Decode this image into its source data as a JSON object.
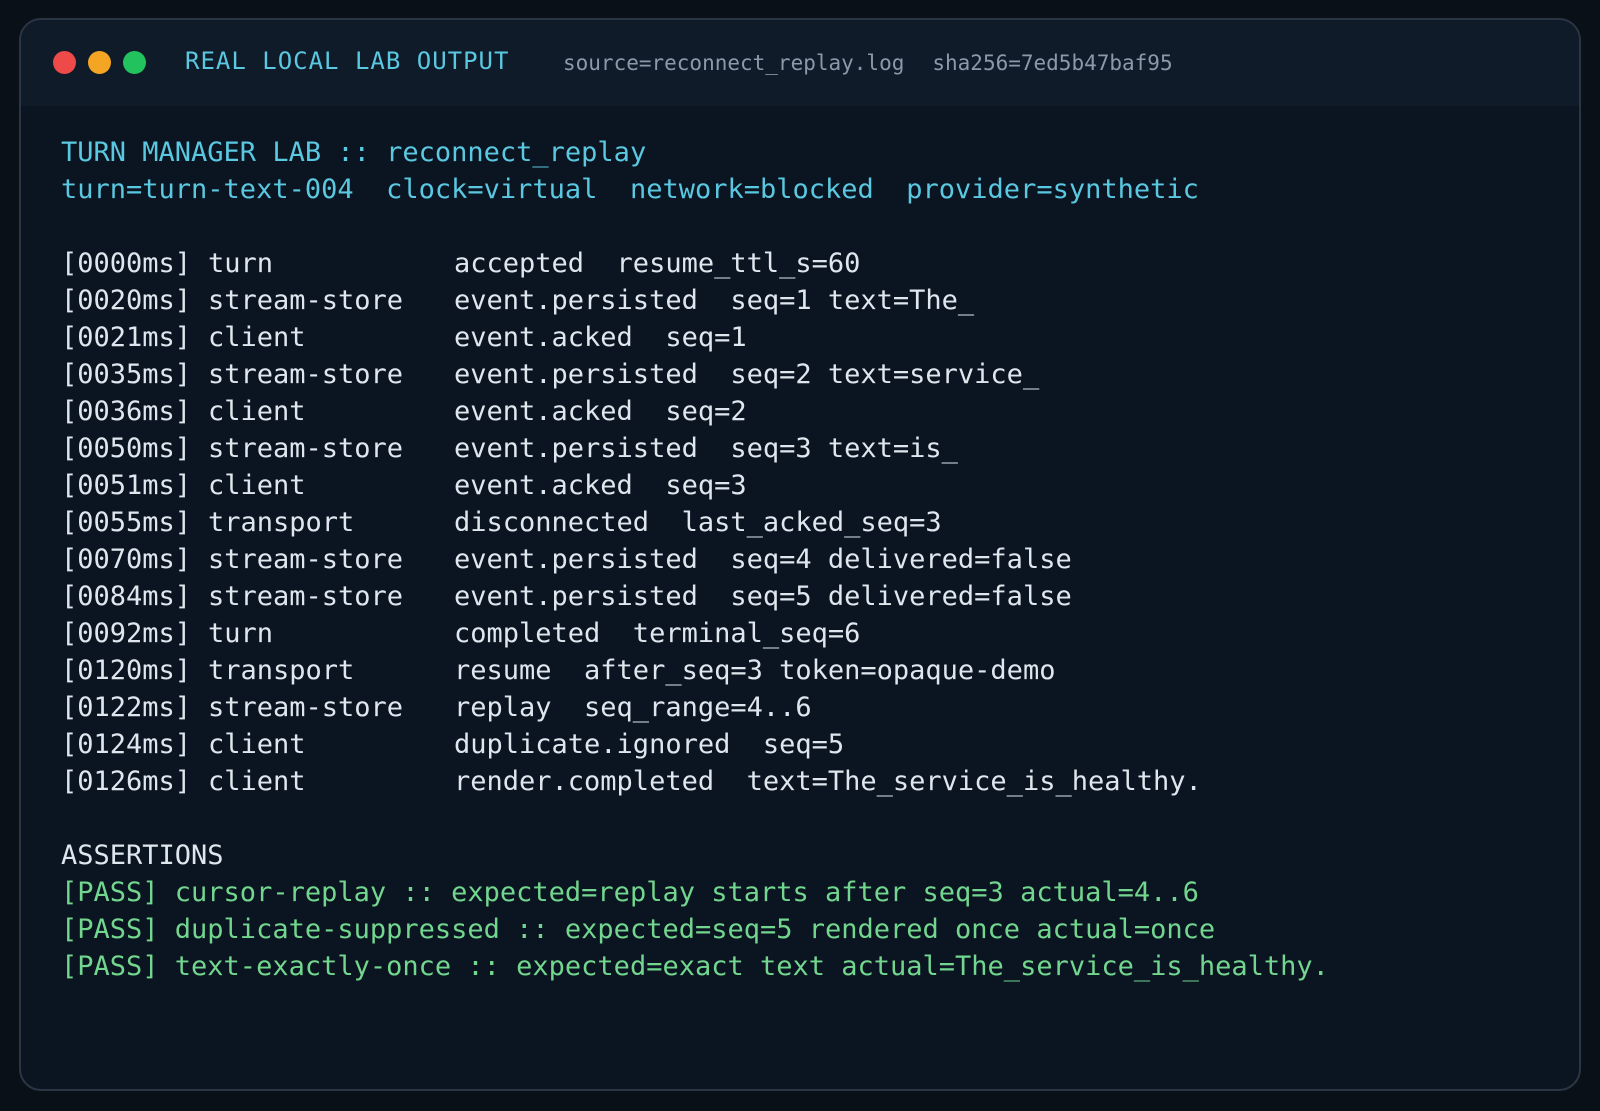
{
  "window": {
    "title": "REAL LOCAL LAB OUTPUT",
    "source": "source=reconnect_replay.log",
    "sha": "sha256=7ed5b47baf95"
  },
  "header": {
    "line1": "TURN MANAGER LAB :: reconnect_replay",
    "line2": "turn=turn-text-004  clock=virtual  network=blocked  provider=synthetic"
  },
  "log": [
    {
      "time": "[0000ms]",
      "source": "turn",
      "message": "accepted  resume_ttl_s=60"
    },
    {
      "time": "[0020ms]",
      "source": "stream-store",
      "message": "event.persisted  seq=1 text=The_"
    },
    {
      "time": "[0021ms]",
      "source": "client",
      "message": "event.acked  seq=1"
    },
    {
      "time": "[0035ms]",
      "source": "stream-store",
      "message": "event.persisted  seq=2 text=service_"
    },
    {
      "time": "[0036ms]",
      "source": "client",
      "message": "event.acked  seq=2"
    },
    {
      "time": "[0050ms]",
      "source": "stream-store",
      "message": "event.persisted  seq=3 text=is_"
    },
    {
      "time": "[0051ms]",
      "source": "client",
      "message": "event.acked  seq=3"
    },
    {
      "time": "[0055ms]",
      "source": "transport",
      "message": "disconnected  last_acked_seq=3"
    },
    {
      "time": "[0070ms]",
      "source": "stream-store",
      "message": "event.persisted  seq=4 delivered=false"
    },
    {
      "time": "[0084ms]",
      "source": "stream-store",
      "message": "event.persisted  seq=5 delivered=false"
    },
    {
      "time": "[0092ms]",
      "source": "turn",
      "message": "completed  terminal_seq=6"
    },
    {
      "time": "[0120ms]",
      "source": "transport",
      "message": "resume  after_seq=3 token=opaque-demo"
    },
    {
      "time": "[0122ms]",
      "source": "stream-store",
      "message": "replay  seq_range=4..6"
    },
    {
      "time": "[0124ms]",
      "source": "client",
      "message": "duplicate.ignored  seq=5"
    },
    {
      "time": "[0126ms]",
      "source": "client",
      "message": "render.completed  text=The_service_is_healthy."
    }
  ],
  "assertions": {
    "heading": "ASSERTIONS",
    "items": [
      "[PASS] cursor-replay :: expected=replay starts after seq=3 actual=4..6",
      "[PASS] duplicate-suppressed :: expected=seq=5 rendered once actual=once",
      "[PASS] text-exactly-once :: expected=exact text actual=The_service_is_healthy."
    ]
  },
  "colors": {
    "background": "#0a1018",
    "titlebar": "#101b2a",
    "accent": "#5ac8e0",
    "pass": "#72d68e",
    "text": "#dfe6ee",
    "muted": "#8d99a8",
    "close": "#ef4a4a",
    "minimize": "#f5a524",
    "maximize": "#22c35e"
  }
}
